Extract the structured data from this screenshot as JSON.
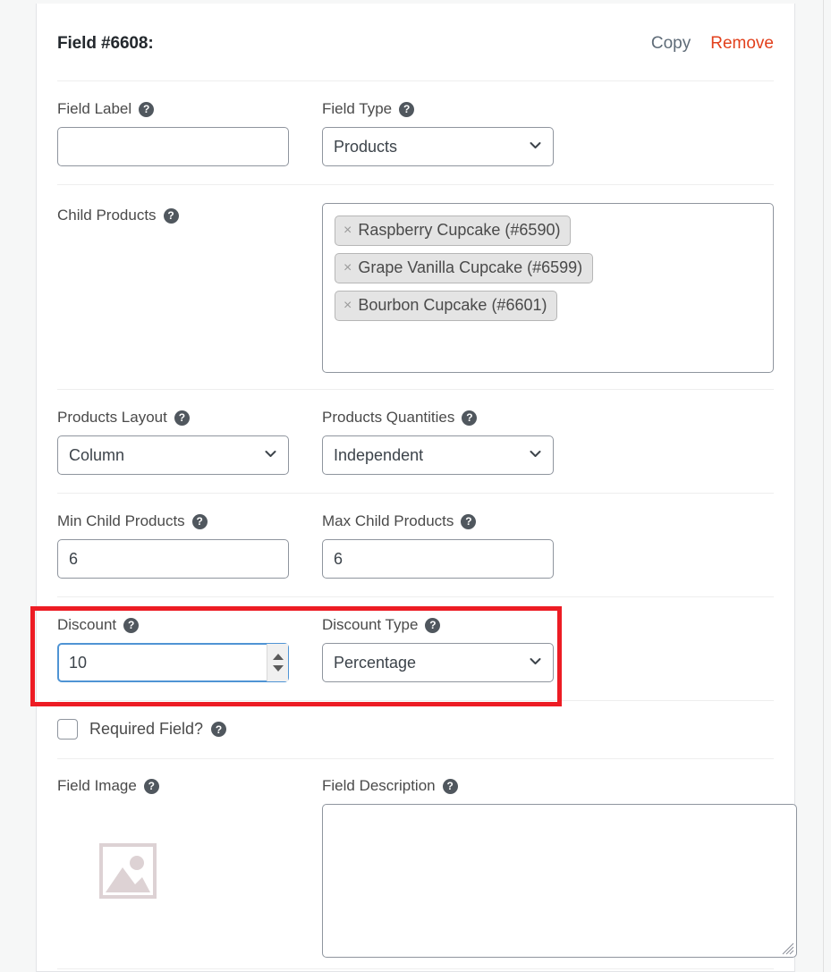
{
  "header": {
    "title": "Field #6608:",
    "copy_label": "Copy",
    "remove_label": "Remove",
    "copy_color": "#5f6c78",
    "remove_color": "#e2401c"
  },
  "help_glyph": "?",
  "fields": {
    "field_label": {
      "label": "Field Label",
      "value": "",
      "placeholder": ""
    },
    "field_type": {
      "label": "Field Type",
      "value": "Products",
      "options": [
        "Products"
      ]
    },
    "child_products": {
      "label": "Child Products",
      "tags": [
        {
          "remove_glyph": "×",
          "text": "Raspberry Cupcake (#6590)"
        },
        {
          "remove_glyph": "×",
          "text": "Grape Vanilla Cupcake (#6599)"
        },
        {
          "remove_glyph": "×",
          "text": "Bourbon Cupcake (#6601)"
        }
      ]
    },
    "products_layout": {
      "label": "Products Layout",
      "value": "Column",
      "options": [
        "Column"
      ]
    },
    "products_quantities": {
      "label": "Products Quantities",
      "value": "Independent",
      "options": [
        "Independent"
      ]
    },
    "min_child_products": {
      "label": "Min Child Products",
      "value": "6"
    },
    "max_child_products": {
      "label": "Max Child Products",
      "value": "6"
    },
    "discount": {
      "label": "Discount",
      "value": "10",
      "focused": true
    },
    "discount_type": {
      "label": "Discount Type",
      "value": "Percentage",
      "options": [
        "Percentage"
      ]
    },
    "required_field": {
      "label": "Required Field?",
      "checked": false
    },
    "field_image": {
      "label": "Field Image"
    },
    "field_description": {
      "label": "Field Description",
      "value": ""
    }
  },
  "annotation": {
    "highlight_color": "#ed1c24"
  }
}
